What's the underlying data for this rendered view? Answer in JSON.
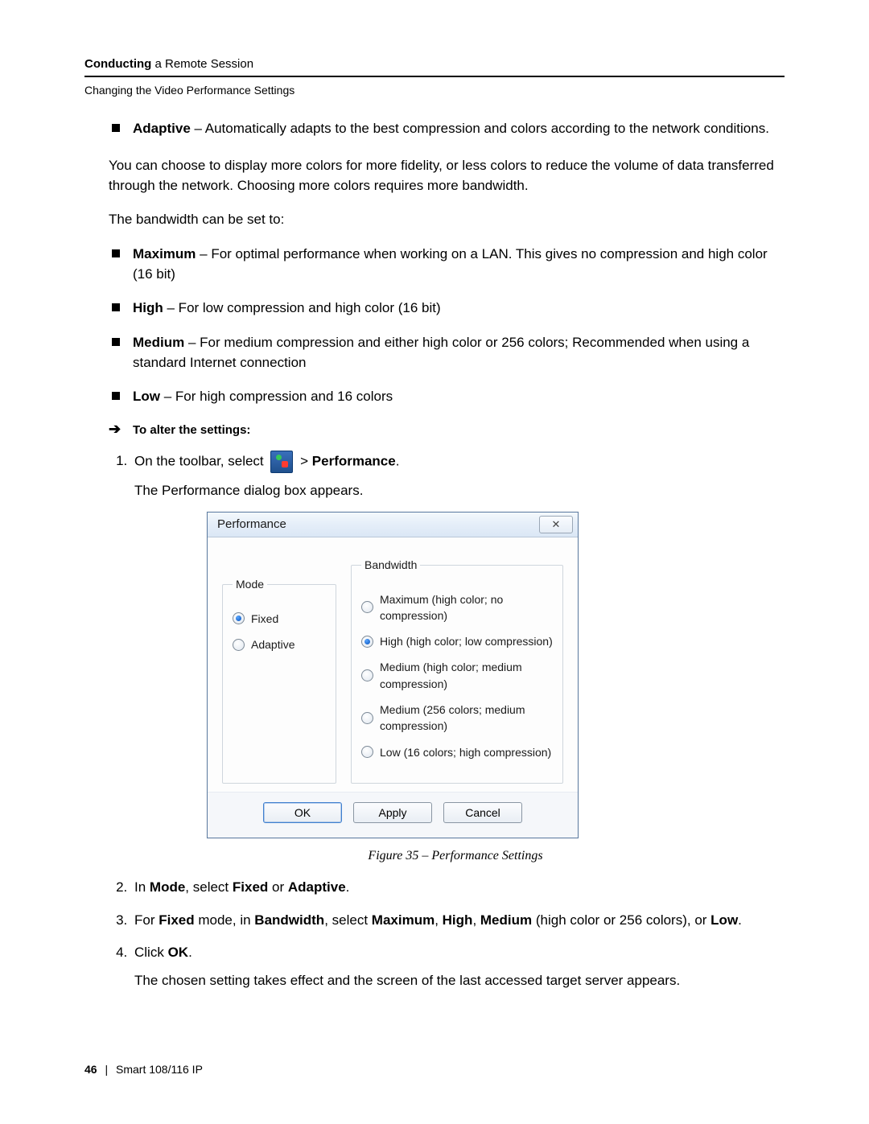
{
  "header": {
    "title_bold": "Conducting",
    "title_rest": " a Remote Session",
    "subtitle": "Changing the Video Performance Settings"
  },
  "adaptive_bullet": {
    "lead": "Adaptive",
    "text": " – Automatically adapts to the best compression and colors according to the network conditions."
  },
  "para_colors": "You can choose to display more colors for more fidelity, or less colors to reduce the volume of data transferred through the network. Choosing more colors requires more bandwidth.",
  "para_bw_intro": "The bandwidth can be set to:",
  "bw_bullets": [
    {
      "lead": "Maximum",
      "text": " – For optimal performance when working on a LAN. This gives no compression and high color (16 bit)"
    },
    {
      "lead": "High",
      "text": " – For low compression and high color (16 bit)"
    },
    {
      "lead": "Medium",
      "text": " – For medium compression and either high color or 256 colors; Recommended when using a standard Internet connection"
    },
    {
      "lead": "Low",
      "text": " – For high compression and 16 colors"
    }
  ],
  "to_alter": "To alter the settings:",
  "step1_prefix": "On the toolbar, select ",
  "step1_gt": " > ",
  "step1_perf": "Performance",
  "step1_dot": ".",
  "step1_sub": "The Performance dialog box appears.",
  "dialog": {
    "title": "Performance",
    "close": "✕",
    "mode_legend": "Mode",
    "mode_options": [
      "Fixed",
      "Adaptive"
    ],
    "mode_selected_index": 0,
    "bw_legend": "Bandwidth",
    "bw_options": [
      "Maximum (high color; no compression)",
      "High (high color; low compression)",
      "Medium (high color; medium compression)",
      "Medium (256 colors; medium compression)",
      "Low (16 colors; high compression)"
    ],
    "bw_selected_index": 1,
    "buttons": {
      "ok": "OK",
      "apply": "Apply",
      "cancel": "Cancel"
    }
  },
  "figure_caption": "Figure 35 – Performance Settings",
  "step2": {
    "pre": "In ",
    "b1": "Mode",
    "mid": ", select ",
    "b2": "Fixed",
    "or": " or ",
    "b3": "Adaptive",
    "end": "."
  },
  "step3": {
    "pre": "For ",
    "b1": "Fixed",
    "m1": " mode, in ",
    "b2": "Bandwidth",
    "m2": ", select ",
    "b3": "Maximum",
    "c1": ", ",
    "b4": "High",
    "c2": ", ",
    "b5": "Medium",
    "m3": " (high color or 256 colors), or ",
    "b6": "Low",
    "end": "."
  },
  "step4": {
    "pre": "Click ",
    "b1": "OK",
    "end": "."
  },
  "step4_sub": "The chosen setting takes effect and the screen of the last accessed target server appears.",
  "footer": {
    "page": "46",
    "product": "Smart 108/116 IP"
  }
}
